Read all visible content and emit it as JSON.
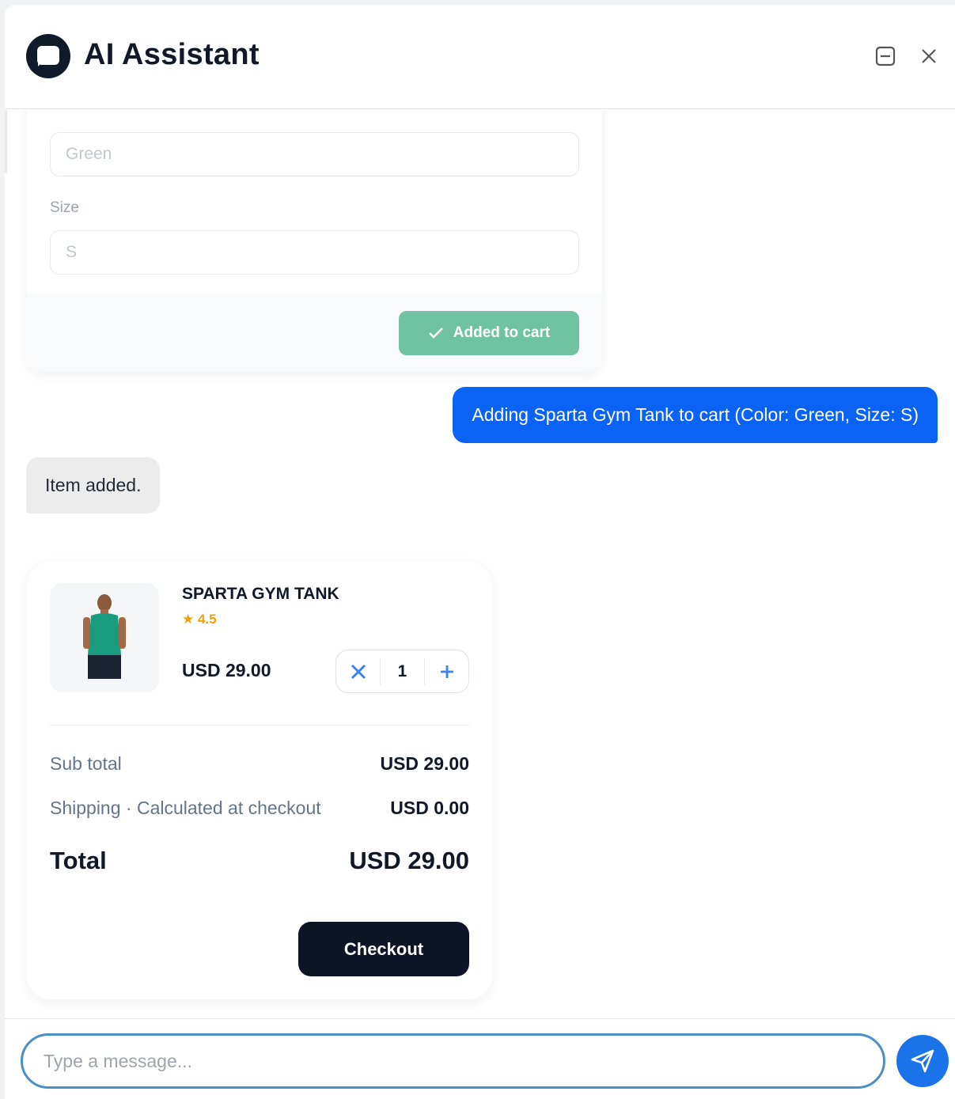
{
  "header": {
    "title": "AI Assistant",
    "minimize_icon": "minimize-icon",
    "close_icon": "close-icon"
  },
  "product_form": {
    "color_value": "Green",
    "size_label": "Size",
    "size_value": "S",
    "added_button_label": "Added to cart",
    "added_icon": "check-icon"
  },
  "messages": {
    "user": "Adding Sparta Gym Tank to cart (Color: Green, Size: S)",
    "bot": "Item added."
  },
  "cart": {
    "product_name": "SPARTA GYM TANK",
    "rating": "★ 4.5",
    "price": "USD 29.00",
    "quantity": "1",
    "remove_icon": "remove-icon",
    "increment_icon": "plus-icon",
    "subtotal_label": "Sub total",
    "subtotal_value": "USD 29.00",
    "shipping_label": "Shipping · Calculated at checkout",
    "shipping_value": "USD 0.00",
    "total_label": "Total",
    "total_value": "USD 29.00",
    "checkout_label": "Checkout"
  },
  "input": {
    "placeholder": "Type a message..."
  },
  "colors": {
    "accent": "#0a63f5",
    "added_green": "#6fc3a2",
    "checkout_dark": "#0c1426",
    "rating_orange": "#f59e0b"
  }
}
